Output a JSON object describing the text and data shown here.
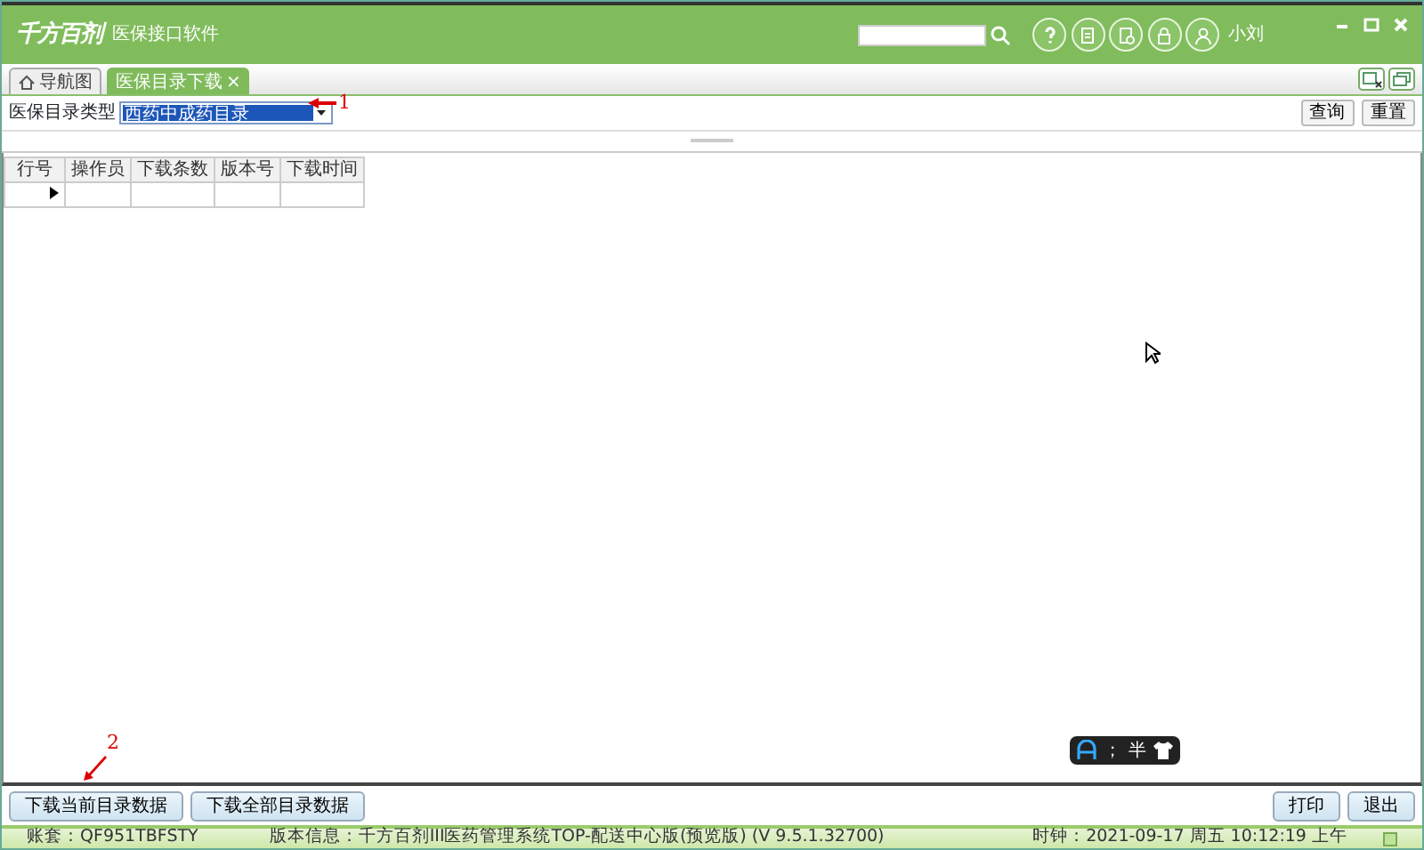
{
  "window": {
    "logo": "千方百剂",
    "title": "医保接口软件",
    "user": "小刘"
  },
  "tabs": [
    {
      "label": "导航图",
      "kind": "home",
      "selected": false
    },
    {
      "label": "医保目录下载",
      "close": "×",
      "kind": "plain",
      "selected": true
    }
  ],
  "filter": {
    "label": "医保目录类型",
    "value": "西药中成药目录",
    "buttons": [
      "查询",
      "重置"
    ]
  },
  "table": {
    "columns": [
      "行号",
      "操作员",
      "下载条数",
      "版本号",
      "下载时间"
    ],
    "rows": [
      {
        "current": true
      }
    ]
  },
  "annotations": [
    {
      "text": "1",
      "kind": "left"
    },
    {
      "text": "2",
      "kind": "down"
    }
  ],
  "ime_bar": {
    "punct": "；",
    "width_mode": "半"
  },
  "left_buttons": [
    "下载当前目录数据",
    "下载全部目录数据"
  ],
  "right_buttons": [
    "打印",
    "退出"
  ],
  "status_bar": {
    "account": "账套：QF951TBFSTY",
    "version": "版本信息：千方百剂III医药管理系统TOP-配送中心版(预览版) (V 9.5.1.32700)",
    "clock": "时钟：2021-09-17 周五 10:12:19 上午"
  }
}
